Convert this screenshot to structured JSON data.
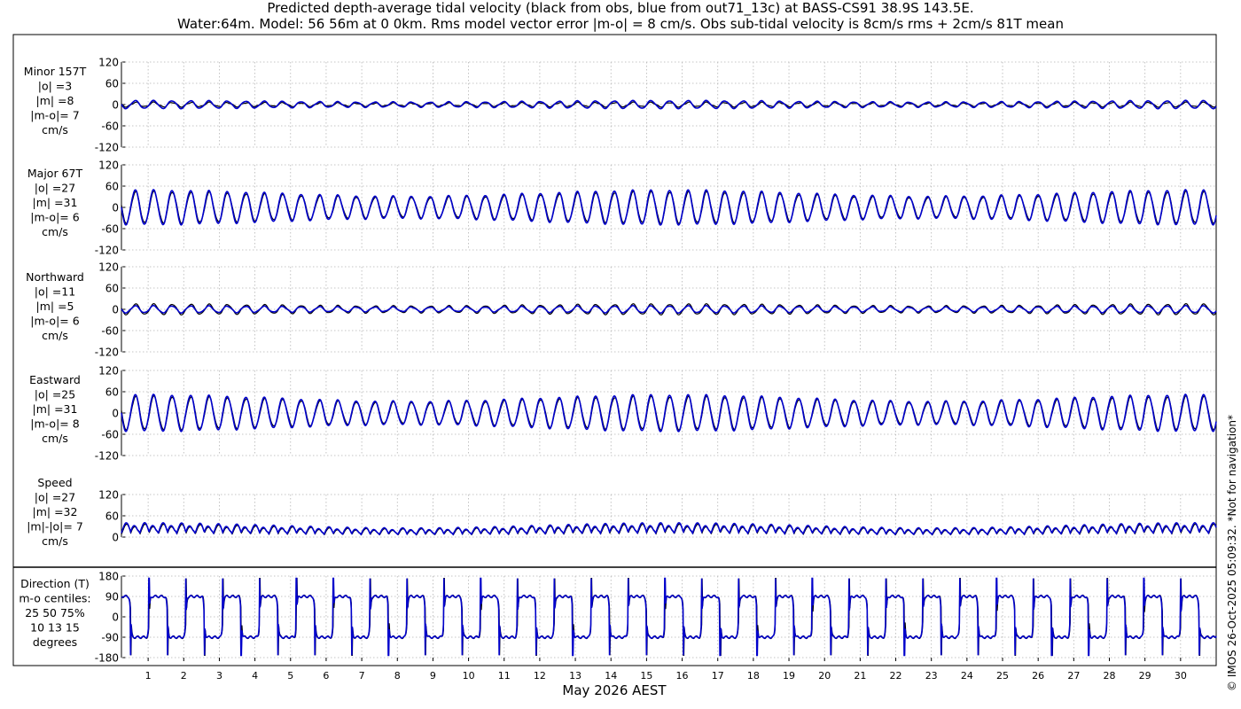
{
  "header": {
    "title_line1": "Predicted depth-average tidal velocity (black from obs, blue from out71_13c) at BASS-CS91 38.9S 143.5E.",
    "title_line2": "Water:64m. Model: 56 56m at 0 0km. Rms model vector error |m-o| = 8 cm/s. Obs sub-tidal velocity is 8cm/s rms + 2cm/s 81T mean"
  },
  "footer": {
    "xlabel": "May 2026 AEST",
    "copyright": "© IMOS 26-Oct-2025 05:09:32. *Not for navigation*"
  },
  "chart_data": {
    "type": "line",
    "x_ticks": [
      "1",
      "2",
      "3",
      "4",
      "5",
      "6",
      "7",
      "8",
      "9",
      "10",
      "11",
      "12",
      "13",
      "14",
      "15",
      "16",
      "17",
      "18",
      "19",
      "20",
      "21",
      "22",
      "23",
      "24",
      "25",
      "26",
      "27",
      "28",
      "29",
      "30"
    ],
    "x_range_days": [
      0.25,
      31.0
    ],
    "colors": {
      "obs": "#000000",
      "model": "#0000cc"
    },
    "panels": [
      {
        "id": "minor",
        "labels": [
          "Minor 157T",
          "|o| =3",
          "|m| =8",
          "|m-o|= 7",
          "cm/s"
        ],
        "ylim": [
          -120,
          120
        ],
        "yticks": [
          "120",
          "60",
          "0",
          "-60",
          "-120"
        ],
        "obs_amplitude": 5,
        "model_amplitude": 9
      },
      {
        "id": "major",
        "labels": [
          "Major 67T",
          "|o| =27",
          "|m| =31",
          "|m-o|= 6",
          "cm/s"
        ],
        "ylim": [
          -120,
          120
        ],
        "yticks": [
          "120",
          "60",
          "0",
          "-60",
          "-120"
        ],
        "obs_amplitude": 36,
        "model_amplitude": 40
      },
      {
        "id": "northward",
        "labels": [
          "Northward",
          "|o| =11",
          "|m| =5",
          "|m-o|= 6",
          "cm/s"
        ],
        "ylim": [
          -120,
          120
        ],
        "yticks": [
          "120",
          "60",
          "0",
          "-60",
          "-120"
        ],
        "obs_amplitude": 12,
        "model_amplitude": 8
      },
      {
        "id": "eastward",
        "labels": [
          "Eastward",
          "|o| =25",
          "|m| =31",
          "|m-o|= 8",
          "cm/s"
        ],
        "ylim": [
          -120,
          120
        ],
        "yticks": [
          "120",
          "60",
          "0",
          "-60",
          "-120"
        ],
        "obs_amplitude": 38,
        "model_amplitude": 42
      },
      {
        "id": "speed",
        "labels": [
          "Speed",
          "|o| =27",
          "|m| =32",
          "|m|-|o|= 7",
          "cm/s"
        ],
        "ylim": [
          0,
          120
        ],
        "yticks": [
          "120",
          "60",
          "0"
        ],
        "obs_amplitude": 36,
        "model_amplitude": 40
      },
      {
        "id": "direction",
        "labels": [
          "Direction (T)",
          "m-o centiles:",
          "25  50  75%",
          "10  13  15",
          "degrees"
        ],
        "ylim": [
          -180,
          180
        ],
        "yticks": [
          "180",
          "90",
          "0",
          "-90",
          "-180"
        ],
        "obs_amplitude": 90,
        "model_amplitude": 90
      }
    ]
  }
}
